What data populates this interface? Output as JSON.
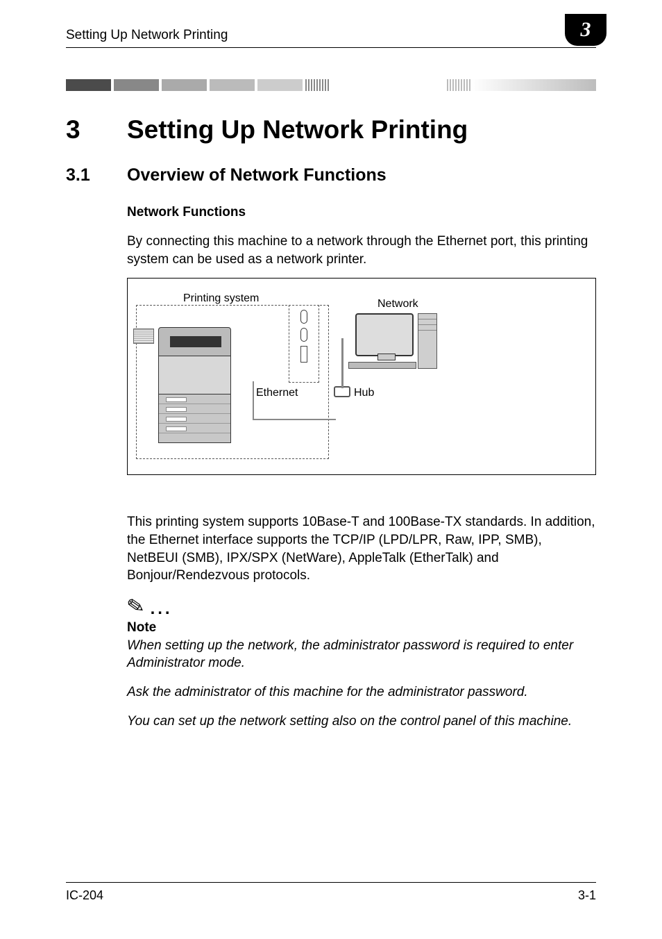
{
  "header": {
    "running_title": "Setting Up Network Printing",
    "chapter_tab": "3"
  },
  "chapter": {
    "number": "3",
    "title": "Setting Up Network Printing"
  },
  "section": {
    "number": "3.1",
    "title": "Overview of Network Functions"
  },
  "subsection": {
    "heading": "Network Functions",
    "intro": "By connecting this machine to a network through the Ethernet port, this printing system can be used as a network printer."
  },
  "diagram": {
    "labels": {
      "printing_system": "Printing system",
      "network": "Network",
      "ethernet": "Ethernet",
      "hub": "Hub"
    }
  },
  "paragraph2": "This printing system supports 10Base-T and 100Base-TX standards. In addition, the Ethernet interface supports the TCP/IP (LPD/LPR, Raw, IPP, SMB), NetBEUI (SMB), IPX/SPX (NetWare), AppleTalk (EtherTalk) and Bonjour/Rendezvous protocols.",
  "note": {
    "label": "Note",
    "p1": "When setting up the network, the administrator password is required to enter Administrator mode.",
    "p2": "Ask the administrator of this machine for the administrator password.",
    "p3": "You can set up the network setting also on the control panel of this machine."
  },
  "footer": {
    "model": "IC-204",
    "page": "3-1"
  }
}
